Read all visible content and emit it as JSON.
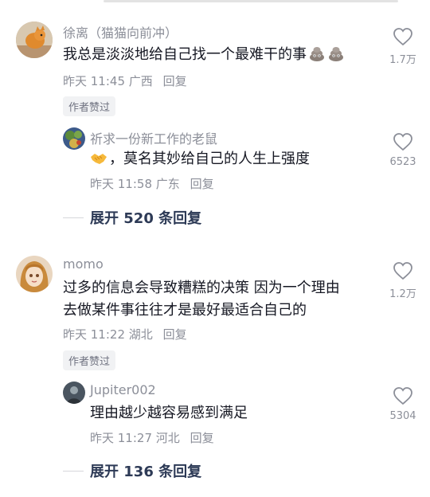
{
  "comments": [
    {
      "username": "徐离（猫猫向前冲）",
      "text": "我总是淡淡地给自己找一个最难干的事",
      "text_emojis": [
        "poop-emoji",
        "poop-emoji"
      ],
      "time": "昨天 11:45",
      "location": "广西",
      "reply_label": "回复",
      "badge": "作者赞过",
      "likes": "1.7万",
      "reply": {
        "username": "祈求一份新工作的老鼠",
        "emoji": "handshake-emoji",
        "text": "，莫名其妙给自己的人生上强度",
        "time": "昨天 11:58",
        "location": "广东",
        "reply_label": "回复",
        "likes": "6523"
      },
      "expand_label": "展开 520 条回复"
    },
    {
      "username": "momo",
      "text_lines": [
        "过多的信息会导致糟糕的决策 因为一个理由",
        "去做某件事往往才是最好最适合自己的"
      ],
      "time": "昨天 11:22",
      "location": "湖北",
      "reply_label": "回复",
      "badge": "作者赞过",
      "likes": "1.2万",
      "reply": {
        "username": "Jupiter002",
        "text": "理由越少越容易感到满足",
        "time": "昨天 11:27",
        "location": "河北",
        "reply_label": "回复",
        "likes": "5304"
      },
      "expand_label": "展开 136 条回复"
    }
  ]
}
